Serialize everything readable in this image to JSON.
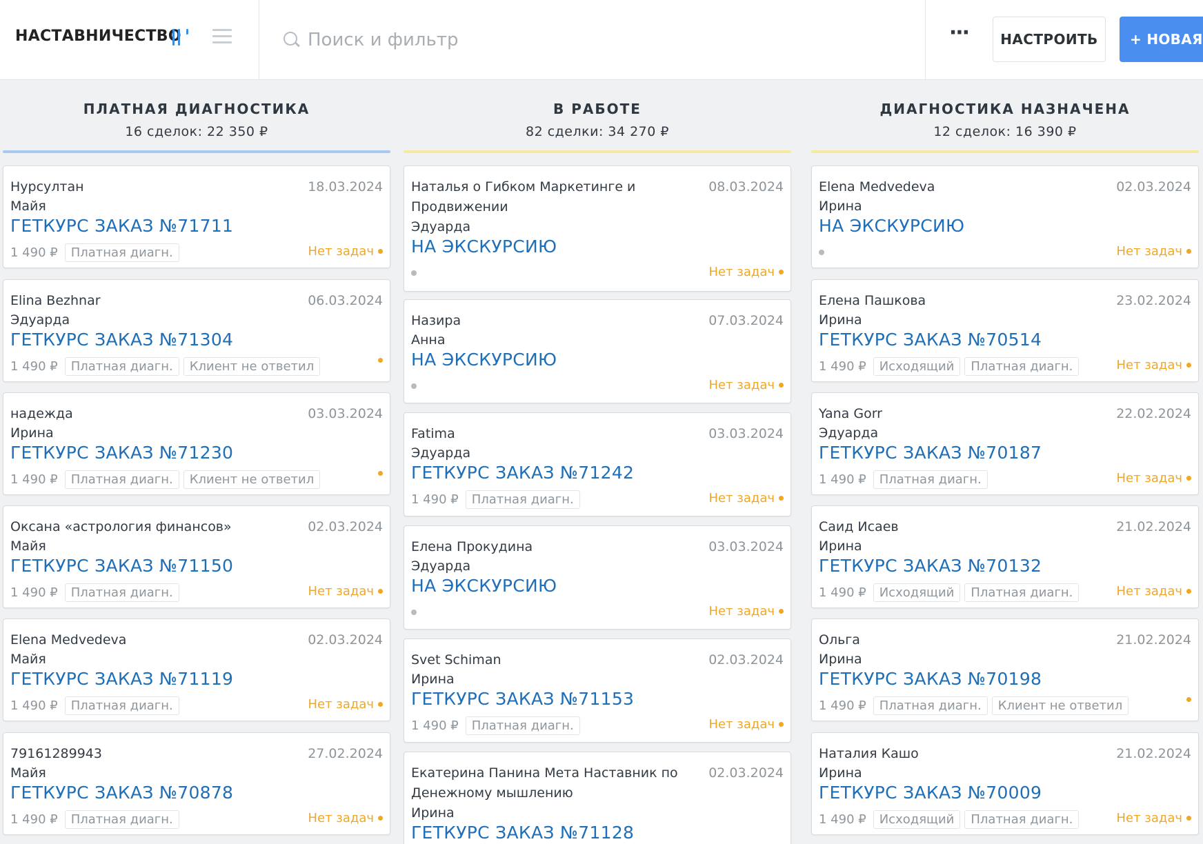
{
  "topbar": {
    "brand": "НАСТАВНИЧЕСТВО",
    "search_placeholder": "Поиск и фильтр",
    "more": "···",
    "settings_label": "НАСТРОИТЬ",
    "new_label": "+ НОВАЯ"
  },
  "colors": {
    "accent": "#4a8ff0",
    "link": "#1f6fb8",
    "task_warning": "#f0a726",
    "column_1_line": "#a8c9f0",
    "column_2_line": "#f5eaa0",
    "column_3_line": "#f5eaa0"
  },
  "columns": [
    {
      "title": "ПЛАТНАЯ ДИАГНОСТИКА",
      "summary": "16 сделок: 22 350 ₽",
      "cards": [
        {
          "name": "Нурсултан",
          "date": "18.03.2024",
          "responsible": "Майя",
          "order": "ГЕТКУРС ЗАКАЗ №71711",
          "price": "1 490 ₽",
          "tags": [
            "Платная диагн."
          ],
          "task": "Нет задач"
        },
        {
          "name": "Elina Bezhnar",
          "date": "06.03.2024",
          "responsible": "Эдуарда",
          "order": "ГЕТКУРС ЗАКАЗ №71304",
          "price": "1 490 ₽",
          "tags": [
            "Платная диагн.",
            "Клиент не ответил"
          ],
          "task": ""
        },
        {
          "name": "надежда",
          "date": "03.03.2024",
          "responsible": "Ирина",
          "order": "ГЕТКУРС ЗАКАЗ №71230",
          "price": "1 490 ₽",
          "tags": [
            "Платная диагн.",
            "Клиент не ответил"
          ],
          "task": ""
        },
        {
          "name": "Оксана «астрология финансов»",
          "date": "02.03.2024",
          "responsible": "Майя",
          "order": "ГЕТКУРС ЗАКАЗ №71150",
          "price": "1 490 ₽",
          "tags": [
            "Платная диагн."
          ],
          "task": "Нет задач"
        },
        {
          "name": "Elena Medvedeva",
          "date": "02.03.2024",
          "responsible": "Майя",
          "order": "ГЕТКУРС ЗАКАЗ №71119",
          "price": "1 490 ₽",
          "tags": [
            "Платная диагн."
          ],
          "task": "Нет задач"
        },
        {
          "name": "79161289943",
          "date": "27.02.2024",
          "responsible": "Майя",
          "order": "ГЕТКУРС ЗАКАЗ №70878",
          "price": "1 490 ₽",
          "tags": [
            "Платная диагн."
          ],
          "task": "Нет задач"
        }
      ]
    },
    {
      "title": "В РАБОТЕ",
      "summary": "82 сделки: 34 270 ₽",
      "cards": [
        {
          "name": "Наталья о Гибком Маркетинге и Продвижении",
          "date": "08.03.2024",
          "responsible": "Эдуарда",
          "order": "НА ЭКСКУРСИЮ",
          "price": "",
          "tags": [],
          "task": "Нет задач"
        },
        {
          "name": "Назира",
          "date": "07.03.2024",
          "responsible": "Анна",
          "order": "НА ЭКСКУРСИЮ",
          "price": "",
          "tags": [],
          "task": "Нет задач"
        },
        {
          "name": "Fatima",
          "date": "03.03.2024",
          "responsible": "Эдуарда",
          "order": "ГЕТКУРС ЗАКАЗ №71242",
          "price": "1 490 ₽",
          "tags": [
            "Платная диагн."
          ],
          "task": "Нет задач"
        },
        {
          "name": "Елена Прокудина",
          "date": "03.03.2024",
          "responsible": "Эдуарда",
          "order": "НА ЭКСКУРСИЮ",
          "price": "",
          "tags": [],
          "task": "Нет задач"
        },
        {
          "name": "Svet Schiman",
          "date": "02.03.2024",
          "responsible": "Ирина",
          "order": "ГЕТКУРС ЗАКАЗ №71153",
          "price": "1 490 ₽",
          "tags": [
            "Платная диагн."
          ],
          "task": "Нет задач"
        },
        {
          "name": "Екатерина Панина Мета Наставник по Денежному мышлению",
          "date": "02.03.2024",
          "responsible": "Ирина",
          "order": "ГЕТКУРС ЗАКАЗ №71128",
          "price": "",
          "tags": [],
          "task": ""
        }
      ]
    },
    {
      "title": "ДИАГНОСТИКА НАЗНАЧЕНА",
      "summary": "12 сделок: 16 390 ₽",
      "cards": [
        {
          "name": "Elena Medvedeva",
          "date": "02.03.2024",
          "responsible": "Ирина",
          "order": "НА ЭКСКУРСИЮ",
          "price": "",
          "tags": [],
          "task": "Нет задач"
        },
        {
          "name": "Елена Пашкова",
          "date": "23.02.2024",
          "responsible": "Ирина",
          "order": "ГЕТКУРС ЗАКАЗ №70514",
          "price": "1 490 ₽",
          "tags": [
            "Исходящий",
            "Платная диагн."
          ],
          "task": "Нет задач"
        },
        {
          "name": "Yana Gorr",
          "date": "22.02.2024",
          "responsible": "Эдуарда",
          "order": "ГЕТКУРС ЗАКАЗ №70187",
          "price": "1 490 ₽",
          "tags": [
            "Платная диагн."
          ],
          "task": "Нет задач"
        },
        {
          "name": "Саид Исаев",
          "date": "21.02.2024",
          "responsible": "Ирина",
          "order": "ГЕТКУРС ЗАКАЗ №70132",
          "price": "1 490 ₽",
          "tags": [
            "Исходящий",
            "Платная диагн."
          ],
          "task": "Нет задач"
        },
        {
          "name": "Ольга",
          "date": "21.02.2024",
          "responsible": "Ирина",
          "order": "ГЕТКУРС ЗАКАЗ №70198",
          "price": "1 490 ₽",
          "tags": [
            "Платная диагн.",
            "Клиент не ответил"
          ],
          "task": ""
        },
        {
          "name": "Наталия Кашо",
          "date": "21.02.2024",
          "responsible": "Ирина",
          "order": "ГЕТКУРС ЗАКАЗ №70009",
          "price": "1 490 ₽",
          "tags": [
            "Исходящий",
            "Платная диагн."
          ],
          "task": "Нет задач"
        }
      ]
    }
  ]
}
